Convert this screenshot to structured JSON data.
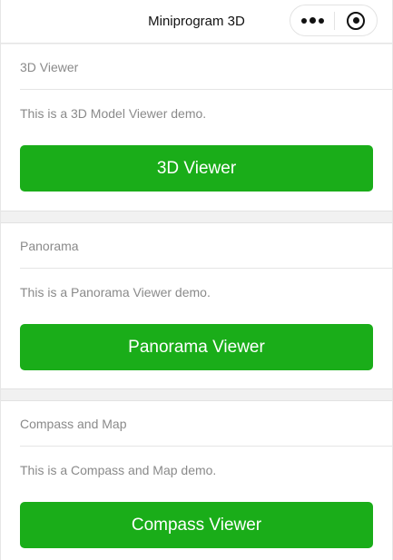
{
  "navbar": {
    "title": "Miniprogram 3D",
    "more_icon": "more-dots-icon",
    "close_icon": "target-circle-icon"
  },
  "sections": [
    {
      "title": "3D Viewer",
      "description": "This is a 3D Model Viewer demo.",
      "button_label": "3D Viewer"
    },
    {
      "title": "Panorama",
      "description": "This is a Panorama Viewer demo.",
      "button_label": "Panorama Viewer"
    },
    {
      "title": "Compass and Map",
      "description": "This is a Compass and Map demo.",
      "button_label": "Compass Viewer"
    }
  ],
  "colors": {
    "primary_button": "#1aad19",
    "button_text": "#ffffff",
    "secondary_text": "#8a8a8a",
    "page_background": "#f1f1f1"
  }
}
